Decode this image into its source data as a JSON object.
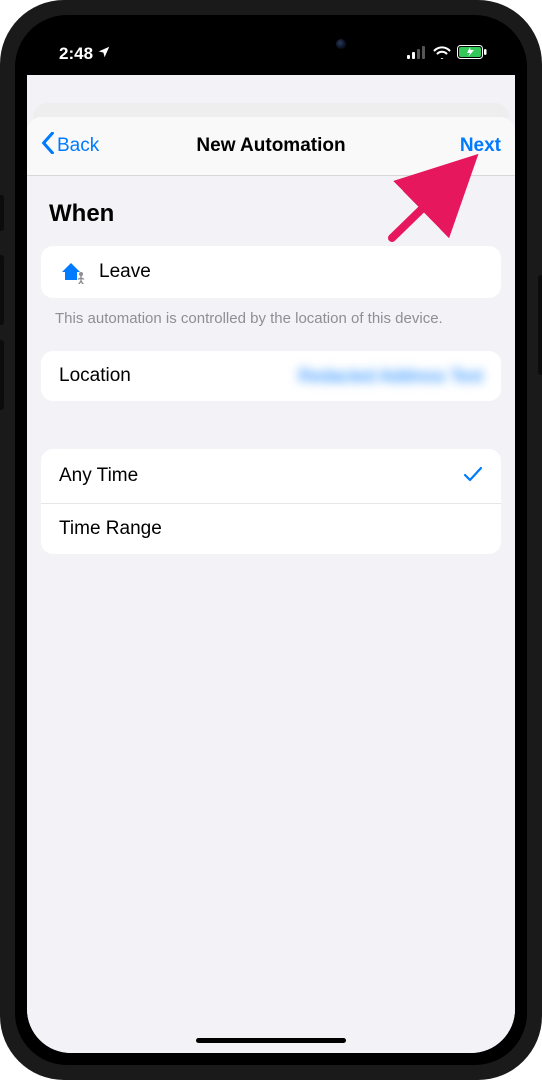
{
  "status": {
    "time": "2:48",
    "location_arrow": true,
    "signal_bars": 2,
    "wifi": true,
    "battery_charging": true
  },
  "nav": {
    "back_label": "Back",
    "title": "New Automation",
    "next_label": "Next"
  },
  "section": {
    "title": "When"
  },
  "trigger": {
    "label": "Leave",
    "icon": "home-leave-icon"
  },
  "footnote": "This automation is controlled by the location of this device.",
  "location_row": {
    "label": "Location",
    "value": "Redacted Address Text"
  },
  "time_options": [
    {
      "label": "Any Time",
      "selected": true
    },
    {
      "label": "Time Range",
      "selected": false
    }
  ],
  "colors": {
    "tint": "#007aff",
    "background": "#f2f2f7"
  }
}
